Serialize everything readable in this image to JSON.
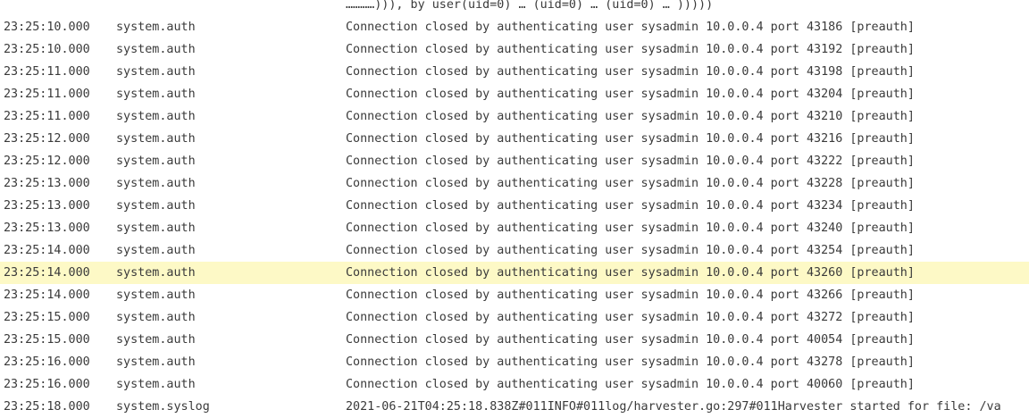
{
  "log": {
    "rows": [
      {
        "time": "",
        "source": "",
        "message": "…………))), by user(uid=0) … (uid=0) … (uid=0) … )))))"
      },
      {
        "time": "23:25:10.000",
        "source": "system.auth",
        "message": "Connection closed by authenticating user sysadmin 10.0.0.4 port 43186 [preauth]"
      },
      {
        "time": "23:25:10.000",
        "source": "system.auth",
        "message": "Connection closed by authenticating user sysadmin 10.0.0.4 port 43192 [preauth]"
      },
      {
        "time": "23:25:11.000",
        "source": "system.auth",
        "message": "Connection closed by authenticating user sysadmin 10.0.0.4 port 43198 [preauth]"
      },
      {
        "time": "23:25:11.000",
        "source": "system.auth",
        "message": "Connection closed by authenticating user sysadmin 10.0.0.4 port 43204 [preauth]"
      },
      {
        "time": "23:25:11.000",
        "source": "system.auth",
        "message": "Connection closed by authenticating user sysadmin 10.0.0.4 port 43210 [preauth]"
      },
      {
        "time": "23:25:12.000",
        "source": "system.auth",
        "message": "Connection closed by authenticating user sysadmin 10.0.0.4 port 43216 [preauth]"
      },
      {
        "time": "23:25:12.000",
        "source": "system.auth",
        "message": "Connection closed by authenticating user sysadmin 10.0.0.4 port 43222 [preauth]"
      },
      {
        "time": "23:25:13.000",
        "source": "system.auth",
        "message": "Connection closed by authenticating user sysadmin 10.0.0.4 port 43228 [preauth]"
      },
      {
        "time": "23:25:13.000",
        "source": "system.auth",
        "message": "Connection closed by authenticating user sysadmin 10.0.0.4 port 43234 [preauth]"
      },
      {
        "time": "23:25:13.000",
        "source": "system.auth",
        "message": "Connection closed by authenticating user sysadmin 10.0.0.4 port 43240 [preauth]"
      },
      {
        "time": "23:25:14.000",
        "source": "system.auth",
        "message": "Connection closed by authenticating user sysadmin 10.0.0.4 port 43254 [preauth]"
      },
      {
        "time": "23:25:14.000",
        "source": "system.auth",
        "message": "Connection closed by authenticating user sysadmin 10.0.0.4 port 43260 [preauth]",
        "highlighted": true
      },
      {
        "time": "23:25:14.000",
        "source": "system.auth",
        "message": "Connection closed by authenticating user sysadmin 10.0.0.4 port 43266 [preauth]"
      },
      {
        "time": "23:25:15.000",
        "source": "system.auth",
        "message": "Connection closed by authenticating user sysadmin 10.0.0.4 port 43272 [preauth]"
      },
      {
        "time": "23:25:15.000",
        "source": "system.auth",
        "message": "Connection closed by authenticating user sysadmin 10.0.0.4 port 40054 [preauth]"
      },
      {
        "time": "23:25:16.000",
        "source": "system.auth",
        "message": "Connection closed by authenticating user sysadmin 10.0.0.4 port 43278 [preauth]"
      },
      {
        "time": "23:25:16.000",
        "source": "system.auth",
        "message": "Connection closed by authenticating user sysadmin 10.0.0.4 port 40060 [preauth]"
      },
      {
        "time": "23:25:18.000",
        "source": "system.syslog",
        "message": "2021-06-21T04:25:18.838Z#011INFO#011log/harvester.go:297#011Harvester started for file: /va"
      }
    ]
  },
  "colors": {
    "highlight": "#fdf9c6",
    "text": "#3a3a3a"
  }
}
